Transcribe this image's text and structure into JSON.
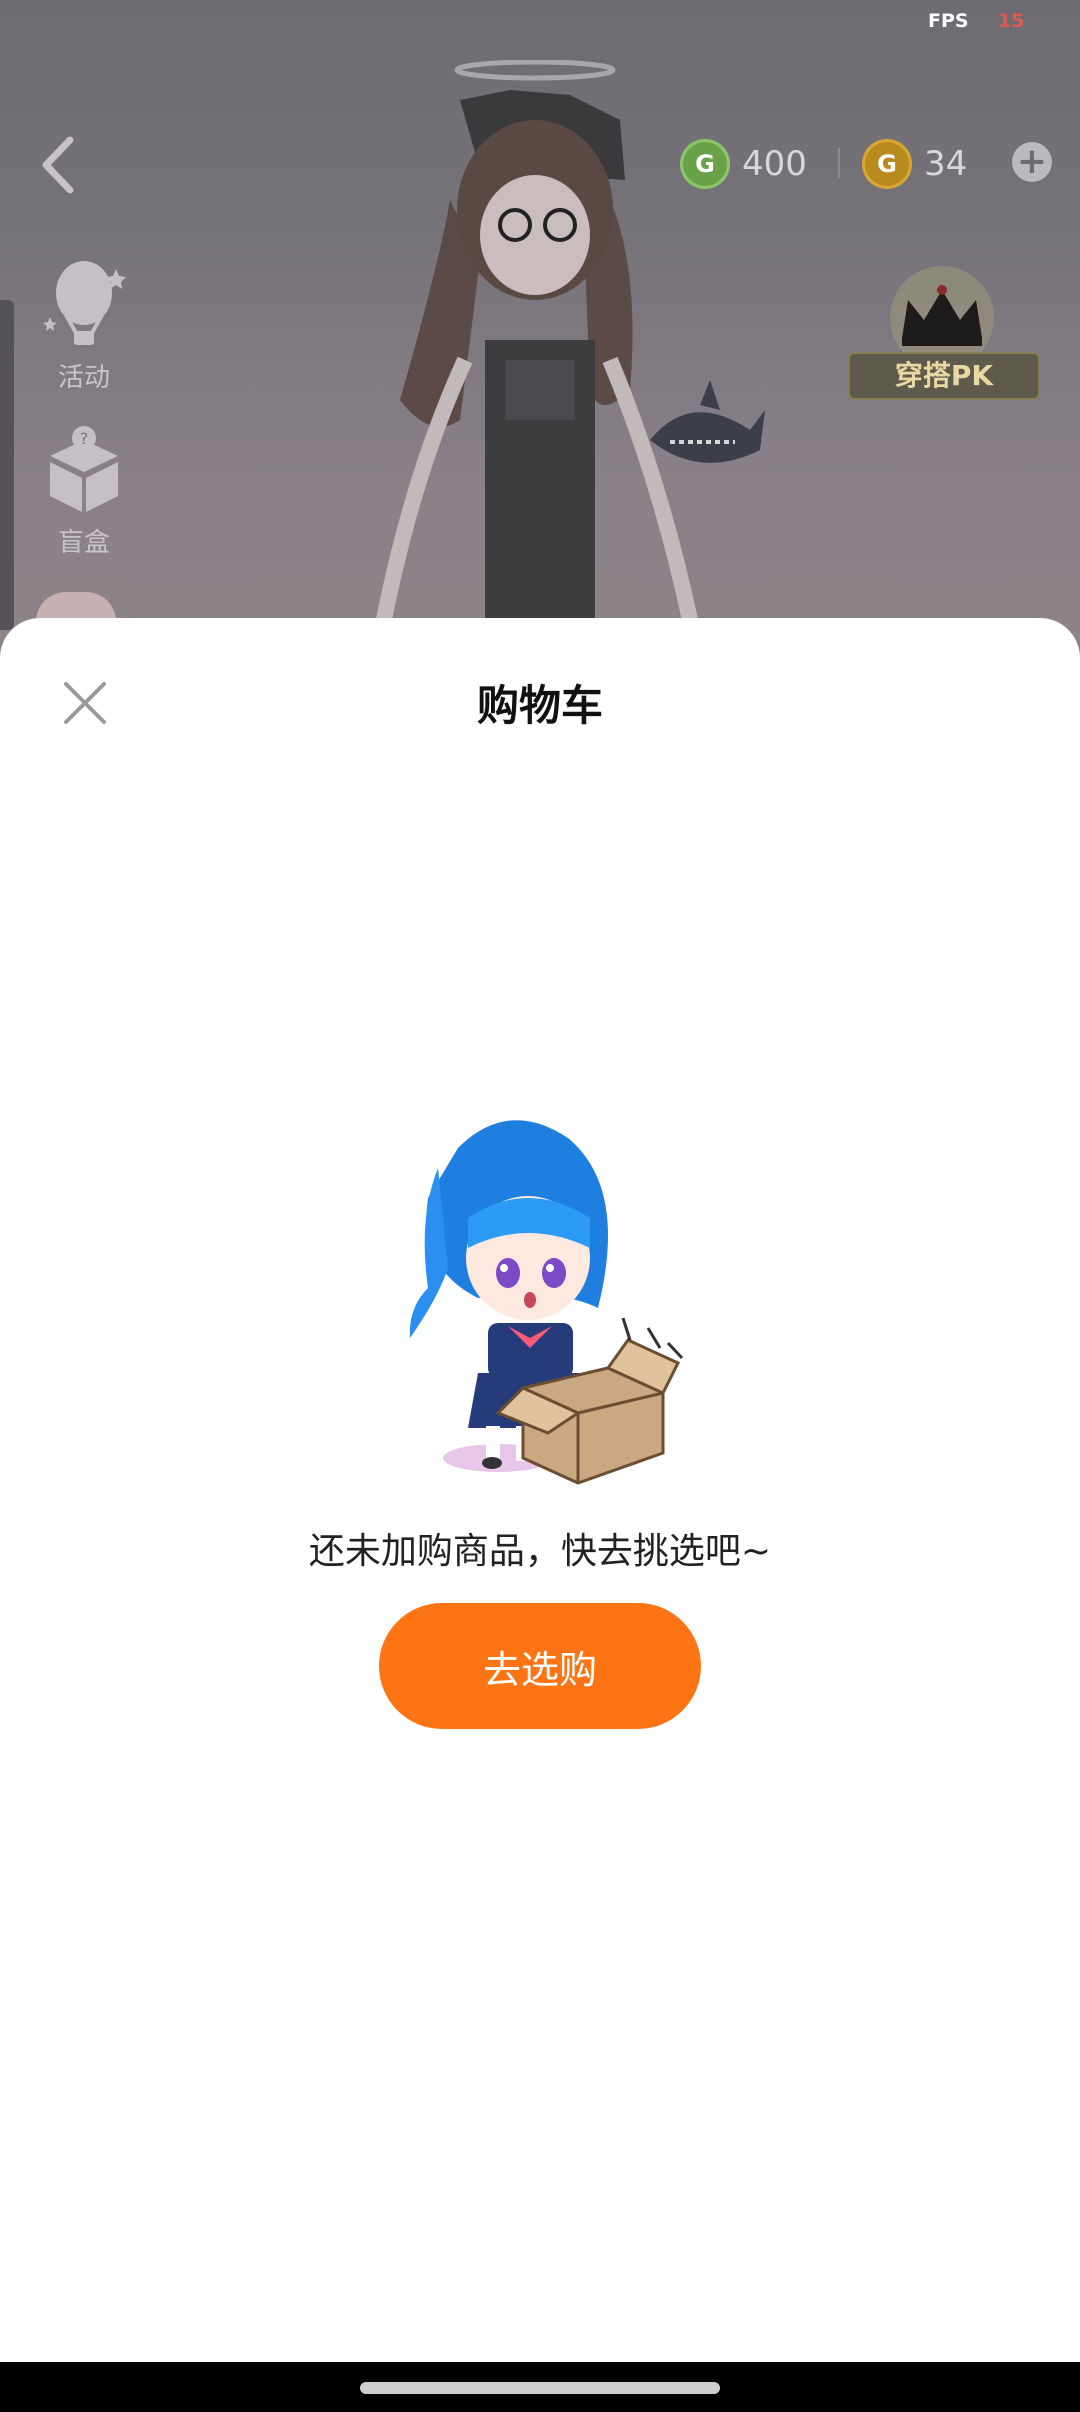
{
  "status": {
    "fps_label": "FPS",
    "fps_value": "15"
  },
  "currency": [
    {
      "icon": "green-coin-icon",
      "symbol": "G",
      "value": "400",
      "color": "#6aa24a"
    },
    {
      "icon": "gold-coin-icon",
      "symbol": "G",
      "value": "34",
      "color": "#d6a833"
    }
  ],
  "sidebar": {
    "items": [
      {
        "label": "活动",
        "icon": "hot-air-balloon-icon"
      },
      {
        "label": "盲盒",
        "icon": "mystery-box-icon"
      }
    ]
  },
  "pk": {
    "label": "穿搭PK",
    "icon": "crown-icon"
  },
  "sheet": {
    "title": "购物车",
    "empty_message": "还未加购商品，快去挑选吧~",
    "shop_button": "去选购",
    "accent": "#fd7414"
  }
}
